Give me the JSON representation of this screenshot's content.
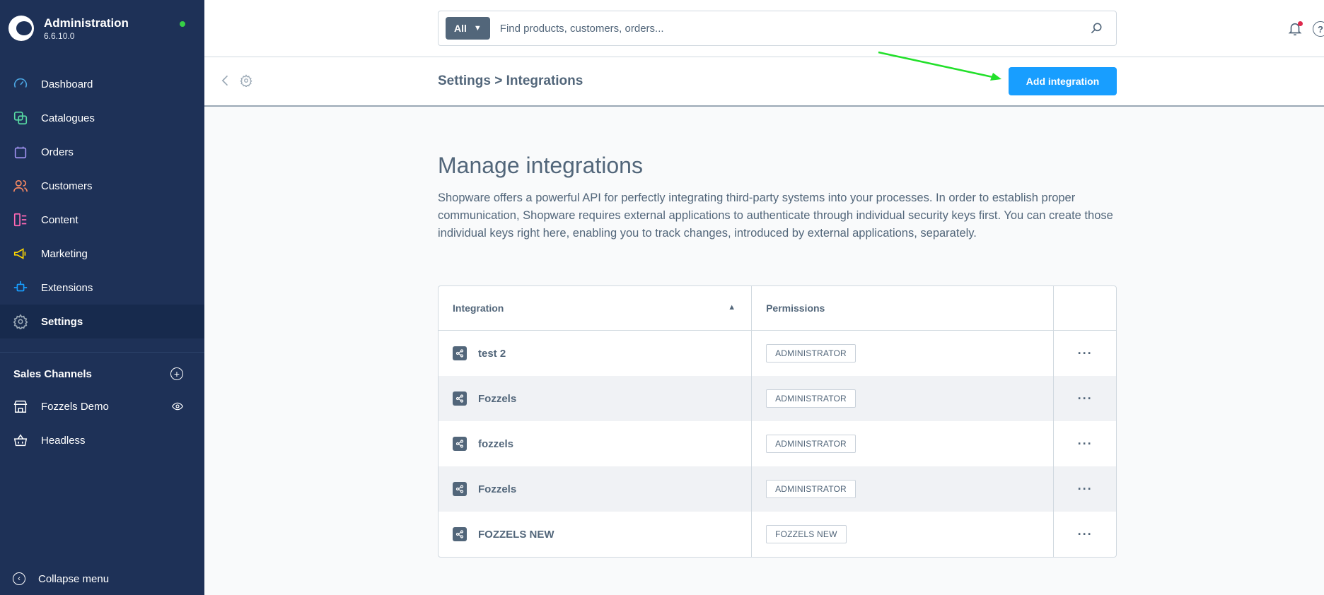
{
  "app": {
    "title": "Administration",
    "version": "6.6.10.0"
  },
  "sidebar": {
    "items": [
      {
        "label": "Dashboard",
        "icon": "dashboard-icon",
        "color": "#4aa3df"
      },
      {
        "label": "Catalogues",
        "icon": "catalogue-icon",
        "color": "#57d9a3"
      },
      {
        "label": "Orders",
        "icon": "orders-icon",
        "color": "#a092f0"
      },
      {
        "label": "Customers",
        "icon": "customers-icon",
        "color": "#f88962"
      },
      {
        "label": "Content",
        "icon": "content-icon",
        "color": "#ff68b4"
      },
      {
        "label": "Marketing",
        "icon": "marketing-icon",
        "color": "#ffd700"
      },
      {
        "label": "Extensions",
        "icon": "extensions-icon",
        "color": "#189eff"
      },
      {
        "label": "Settings",
        "icon": "settings-icon",
        "color": "#9aa8b5"
      }
    ],
    "active": "Settings",
    "sales_channels": {
      "title": "Sales Channels",
      "items": [
        {
          "label": "Fozzels Demo",
          "icon": "storefront-icon"
        },
        {
          "label": "Headless",
          "icon": "basket-icon"
        }
      ]
    },
    "collapse_label": "Collapse menu"
  },
  "search": {
    "type_label": "All",
    "placeholder": "Find products, customers, orders..."
  },
  "smartbar": {
    "title": "Settings > Integrations",
    "add_button": "Add integration"
  },
  "content": {
    "title": "Manage integrations",
    "description": "Shopware offers a powerful API for perfectly integrating third-party systems into your processes. In order to establish proper communication, Shopware requires external applications to authenticate through individual security keys first. You can create those individual keys right here, enabling you to track changes, introduced by external applications, separately."
  },
  "grid": {
    "columns": [
      "Integration",
      "Permissions"
    ],
    "rows": [
      {
        "name": "test 2",
        "permission": "ADMINISTRATOR"
      },
      {
        "name": "Fozzels",
        "permission": "ADMINISTRATOR"
      },
      {
        "name": "fozzels",
        "permission": "ADMINISTRATOR"
      },
      {
        "name": "Fozzels",
        "permission": "ADMINISTRATOR"
      },
      {
        "name": "FOZZELS NEW",
        "permission": "FOZZELS NEW"
      }
    ],
    "actions_label": "···"
  },
  "colors": {
    "sidebar_bg": "#1e3157",
    "accent": "#189eff",
    "annotation_arrow": "#22e02a"
  }
}
